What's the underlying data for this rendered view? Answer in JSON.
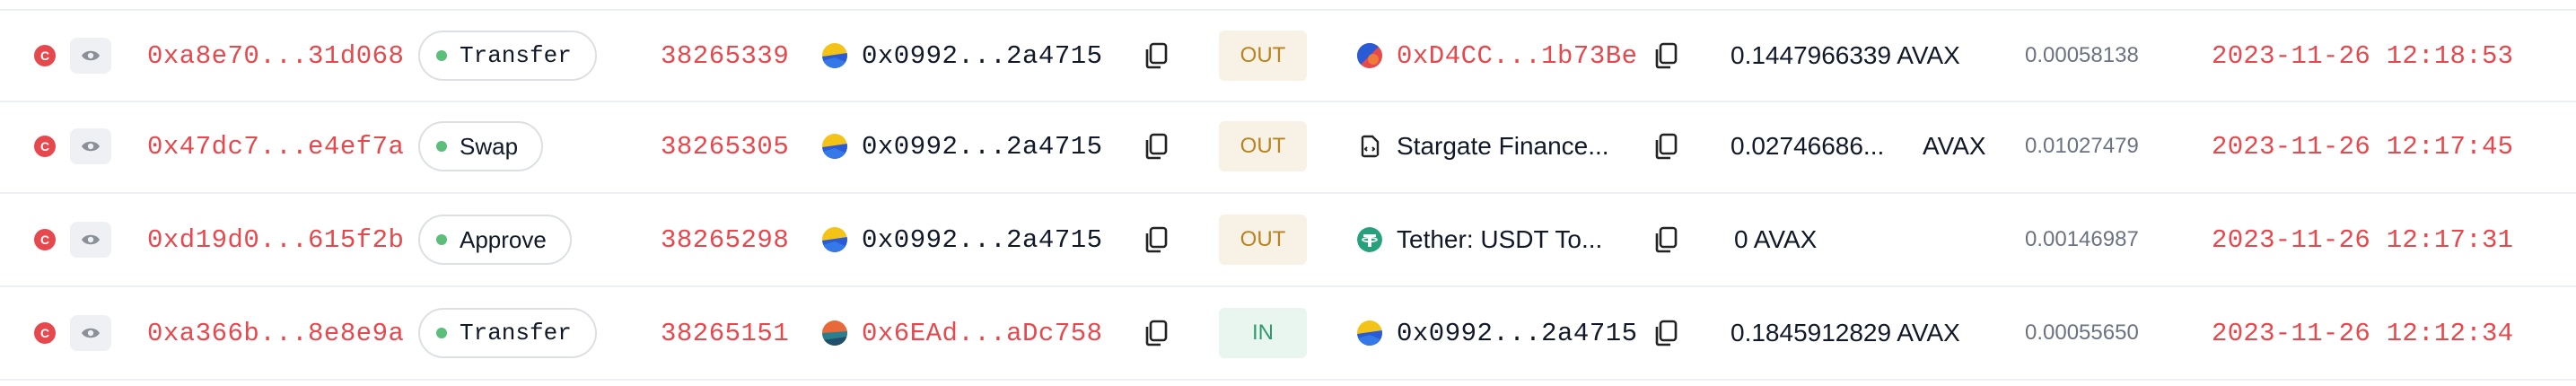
{
  "colors": {
    "accent_red": "#e5484d",
    "out_badge": "#b9831f",
    "in_badge": "#2f9a6b",
    "method_dot": "#5bbf7a"
  },
  "rows": [
    {
      "status": "C",
      "hash": "0xa8e70...31d068",
      "method": "Transfer",
      "block": "38265339",
      "from": "0x0992...2a4715",
      "direction": "OUT",
      "to": "0xD4CC...1b73Be",
      "value": "0.1447966339 AVAX",
      "fee": "0.00058138",
      "time": "2023-11-26 12:18:53"
    },
    {
      "status": "C",
      "hash": "0x47dc7...e4ef7a",
      "method": "Swap",
      "block": "38265305",
      "from": "0x0992...2a4715",
      "direction": "OUT",
      "to": "Stargate Finance...",
      "value": "0.02746686...",
      "value_unit": "AVAX",
      "fee": "0.01027479",
      "time": "2023-11-26 12:17:45"
    },
    {
      "status": "C",
      "hash": "0xd19d0...615f2b",
      "method": "Approve",
      "block": "38265298",
      "from": "0x0992...2a4715",
      "direction": "OUT",
      "to": "Tether: USDT To...",
      "value": "0 AVAX",
      "fee": "0.00146987",
      "time": "2023-11-26 12:17:31"
    },
    {
      "status": "C",
      "hash": "0xa366b...8e8e9a",
      "method": "Transfer",
      "block": "38265151",
      "from": "0x6EAd...aDc758",
      "direction": "IN",
      "to": "0x0992...2a4715",
      "value": "0.1845912829 AVAX",
      "fee": "0.00055650",
      "time": "2023-11-26 12:12:34"
    }
  ]
}
